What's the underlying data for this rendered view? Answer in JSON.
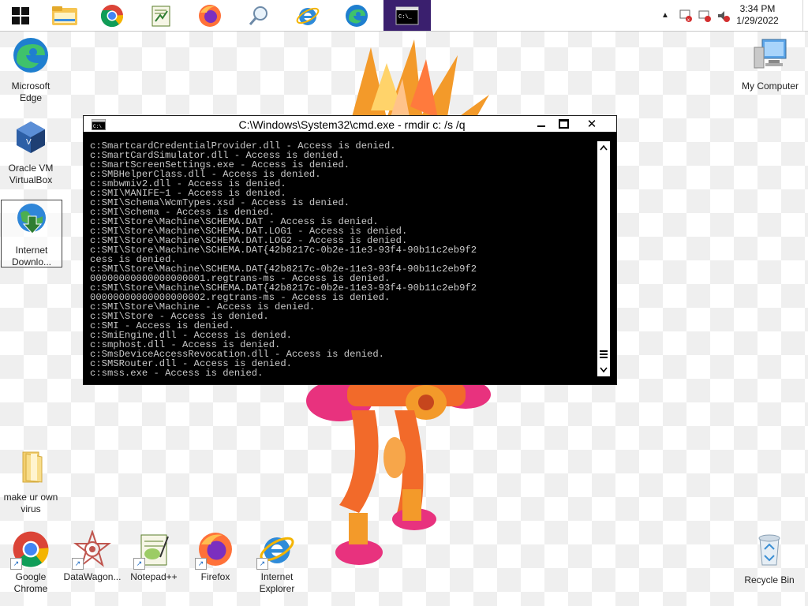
{
  "taskbar": {
    "apps": [
      {
        "name": "File Explorer"
      },
      {
        "name": "Google Chrome"
      },
      {
        "name": "Notepad++"
      },
      {
        "name": "Firefox"
      },
      {
        "name": "Search"
      },
      {
        "name": "Internet Explorer"
      },
      {
        "name": "Microsoft Edge"
      },
      {
        "name": "Command Prompt",
        "active": true
      }
    ],
    "clock": {
      "time": "3:34 PM",
      "date": "1/29/2022"
    }
  },
  "desktop_icons": {
    "left": [
      {
        "label": "Microsoft Edge"
      },
      {
        "label": "Oracle VM VirtualBox"
      },
      {
        "label": "Internet Downlo..."
      },
      {
        "label": "make ur own virus"
      }
    ],
    "bottom": [
      {
        "label": "Google Chrome"
      },
      {
        "label": "DataWagon..."
      },
      {
        "label": "Notepad++"
      },
      {
        "label": "Firefox"
      },
      {
        "label": "Internet Explorer"
      }
    ],
    "right": [
      {
        "label": "My Computer"
      },
      {
        "label": "Recycle Bin"
      }
    ]
  },
  "cmd_window": {
    "title": "C:\\Windows\\System32\\cmd.exe - rmdir  c: /s /q",
    "lines": [
      "c:SmartcardCredentialProvider.dll - Access is denied.",
      "c:SmartCardSimulator.dll - Access is denied.",
      "c:SmartScreenSettings.exe - Access is denied.",
      "c:SMBHelperClass.dll - Access is denied.",
      "c:smbwmiv2.dll - Access is denied.",
      "c:SMI\\MANIFE~1 - Access is denied.",
      "c:SMI\\Schema\\WcmTypes.xsd - Access is denied.",
      "c:SMI\\Schema - Access is denied.",
      "c:SMI\\Store\\Machine\\SCHEMA.DAT - Access is denied.",
      "c:SMI\\Store\\Machine\\SCHEMA.DAT.LOG1 - Access is denied.",
      "c:SMI\\Store\\Machine\\SCHEMA.DAT.LOG2 - Access is denied.",
      "c:SMI\\Store\\Machine\\SCHEMA.DAT{42b8217c-0b2e-11e3-93f4-90b11c2eb9f2",
      "cess is denied.",
      "c:SMI\\Store\\Machine\\SCHEMA.DAT{42b8217c-0b2e-11e3-93f4-90b11c2eb9f2",
      "00000000000000000001.regtrans-ms - Access is denied.",
      "c:SMI\\Store\\Machine\\SCHEMA.DAT{42b8217c-0b2e-11e3-93f4-90b11c2eb9f2",
      "00000000000000000002.regtrans-ms - Access is denied.",
      "c:SMI\\Store\\Machine - Access is denied.",
      "c:SMI\\Store - Access is denied.",
      "c:SMI - Access is denied.",
      "c:SmiEngine.dll - Access is denied.",
      "c:smphost.dll - Access is denied.",
      "c:SmsDeviceAccessRevocation.dll - Access is denied.",
      "c:SMSRouter.dll - Access is denied.",
      "c:smss.exe - Access is denied."
    ]
  }
}
